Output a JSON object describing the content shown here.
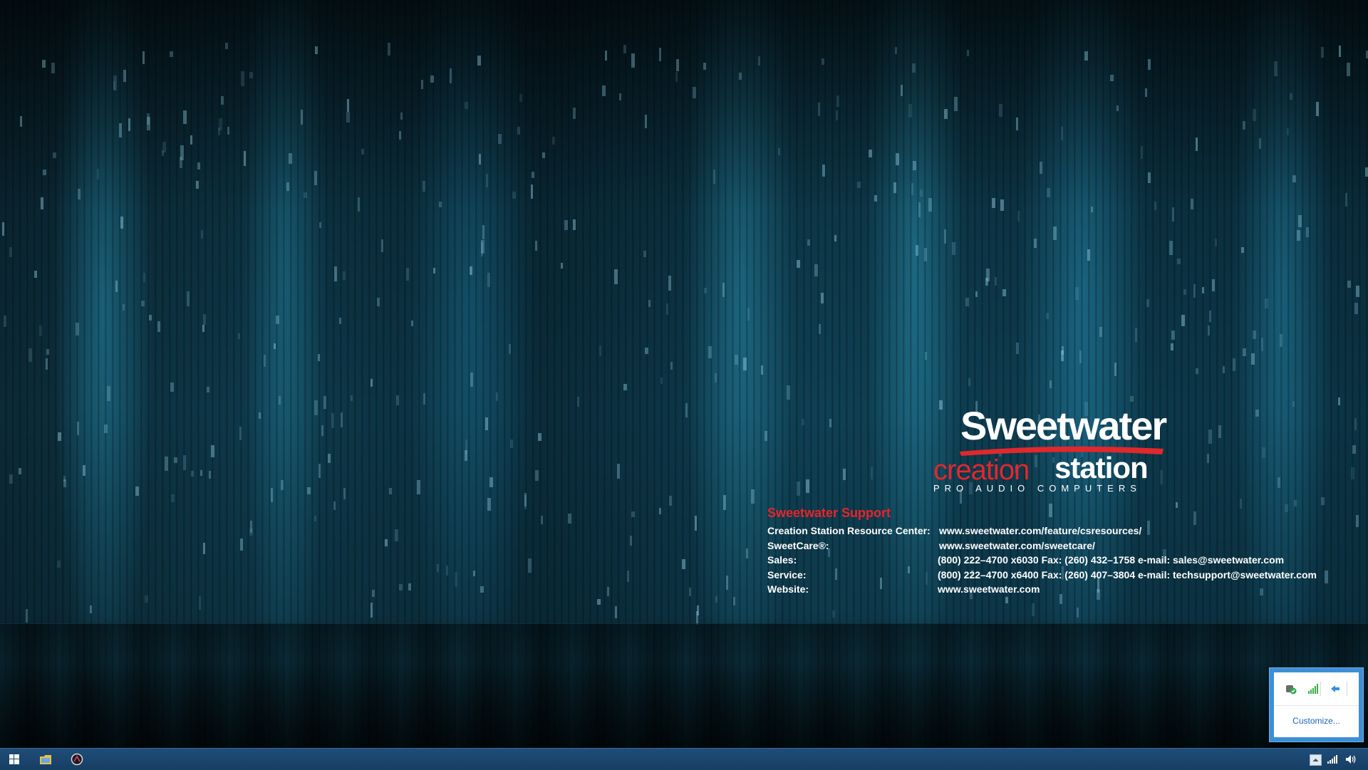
{
  "logo": {
    "wordmark": "Sweetwater",
    "subbrand_part1": "creation",
    "subbrand_part2": "station",
    "tagline": "PRO AUDIO COMPUTERS",
    "trademark_registered": "®",
    "trademark_tm": "™",
    "brand_red": "#e0282d"
  },
  "support": {
    "title": "Sweetwater Support",
    "rows": [
      {
        "label": "Creation Station Resource Center:",
        "value": "www.sweetwater.com/feature/csresources/"
      },
      {
        "label": "SweetCare®:",
        "value": "www.sweetwater.com/sweetcare/"
      },
      {
        "label": "Sales:",
        "value": "(800) 222–4700 x6030  Fax: (260) 432–1758  e-mail: sales@sweetwater.com"
      },
      {
        "label": "Service:",
        "value": "(800) 222–4700 x6400  Fax: (260) 407–3804  e-mail: techsupport@sweetwater.com"
      },
      {
        "label": "Website:",
        "value": "www.sweetwater.com"
      }
    ]
  },
  "tray_popup": {
    "icons": [
      "security-shield-icon",
      "signal-bars-icon",
      "network-sharing-icon"
    ],
    "customize_label": "Customize..."
  },
  "taskbar": {
    "left_icons": [
      "windows-start-icon",
      "file-explorer-icon",
      "app-circle-icon"
    ],
    "right_icons": [
      "show-hidden-icons-arrow",
      "network-signal-icon",
      "volume-icon"
    ]
  }
}
